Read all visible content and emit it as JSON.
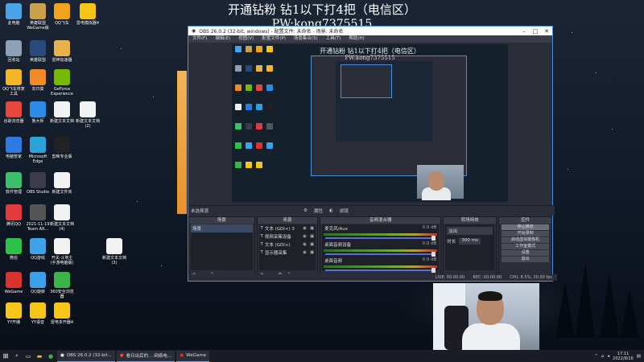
{
  "overlay": {
    "title": "开通钻粉 钻1以下打4把（电信区）",
    "id_line": "PW:kong7375515"
  },
  "desktop": {
    "icons": [
      {
        "label": "此电脑",
        "icon": "computer-icon",
        "color": "#4aa3e8"
      },
      {
        "label": "英雄联盟WeGame版",
        "icon": "lol-icon",
        "color": "#c9a14a"
      },
      {
        "label": "QQ飞车",
        "icon": "qq-speed-icon",
        "color": "#f2a31c"
      },
      {
        "label": "雷电模拟器4",
        "icon": "ldplayer-icon",
        "color": "#f5c518"
      },
      {
        "label": "回收站",
        "icon": "recycle-bin-icon",
        "color": "#8da0b8"
      },
      {
        "label": "英雄联盟",
        "icon": "lol-icon",
        "color": "#2b4a7c"
      },
      {
        "label": "雷神加速器",
        "icon": "leishen-icon",
        "color": "#e8b24a"
      },
      {
        "label": "QQ飞车修复工具",
        "icon": "repair-tool-icon",
        "color": "#f4b626"
      },
      {
        "label": "向日葵",
        "icon": "sunflower-icon",
        "color": "#f08a24"
      },
      {
        "label": "GeForce Experience",
        "icon": "geforce-icon",
        "color": "#76b900"
      },
      {
        "label": "谷歌浏览器",
        "icon": "chrome-icon",
        "color": "#e8453c"
      },
      {
        "label": "鲁大师",
        "icon": "ludashi-icon",
        "color": "#2c8be8"
      },
      {
        "label": "新建文本文档",
        "icon": "text-doc-icon",
        "color": "#f2f2f2"
      },
      {
        "label": "新建文本文档(2)",
        "icon": "text-doc-icon",
        "color": "#f2f2f2"
      },
      {
        "label": "电脑管家",
        "icon": "pc-manager-icon",
        "color": "#2d7be0"
      },
      {
        "label": "Microsoft Edge",
        "icon": "edge-icon",
        "color": "#2aa3d8"
      },
      {
        "label": "剪映专业版",
        "icon": "capcut-icon",
        "color": "#222"
      },
      {
        "label": "软件管理",
        "icon": "software-manager-icon",
        "color": "#3cbf6a"
      },
      {
        "label": "OBS Studio",
        "icon": "obs-icon",
        "color": "#3a3d48"
      },
      {
        "label": "新建文件夹",
        "icon": "text-doc-icon",
        "color": "#f2f2f2"
      },
      {
        "label": "腾讯QQ",
        "icon": "qq-icon",
        "color": "#e23a3a"
      },
      {
        "label": "2021-11-19 Team AR...",
        "icon": "file-icon",
        "color": "#555"
      },
      {
        "label": "新建文本文档(4)",
        "icon": "text-doc-icon",
        "color": "#f2f2f2"
      },
      {
        "label": "微信",
        "icon": "wechat-icon",
        "color": "#2dc14b"
      },
      {
        "label": "QQ游戏",
        "icon": "qq-game-icon",
        "color": "#3da4e8"
      },
      {
        "label": "开关·斗地主(手游电脑版)",
        "icon": "text-doc-icon",
        "color": "#f2f2f2"
      },
      {
        "label": "新建文本文档(3)",
        "icon": "text-doc-icon",
        "color": "#f2f2f2"
      },
      {
        "label": "WeGame",
        "icon": "wegame-icon",
        "color": "#d8332c"
      },
      {
        "label": "QQ旋转",
        "icon": "qq-game-icon",
        "color": "#3ca0e8"
      },
      {
        "label": "360安全浏览器",
        "icon": "browser-360-icon",
        "color": "#3bb34a"
      },
      {
        "label": "YY开播",
        "icon": "yy-icon",
        "color": "#f5c518"
      },
      {
        "label": "YY语音",
        "icon": "yy-icon",
        "color": "#f5c518"
      },
      {
        "label": "雷电多开器4",
        "icon": "ldplayer-icon",
        "color": "#f5c518"
      }
    ]
  },
  "obs": {
    "window_title": "OBS 26.0.2 (32-bit, windows) - 配置文件: 未命名 - 场景: 未命名",
    "menu": [
      "文件(F)",
      "编辑(E)",
      "视图(V)",
      "配置文件(P)",
      "场景集合(S)",
      "工具(T)",
      "帮助(H)"
    ],
    "preview_title": "开通钻粉 钻1以下打4把（电信区）",
    "preview_id": "PW:kong7375515",
    "context_bar": {
      "no_source": "未选择源",
      "properties": "属性",
      "filters": "滤镜"
    },
    "docks": {
      "scenes": {
        "header": "场景",
        "items": [
          "场景"
        ]
      },
      "sources": {
        "header": "来源",
        "items": [
          "文本 (GDI+) 3",
          "视频采集设备",
          "文本 (GDI+)",
          "显示器采集"
        ]
      },
      "mixer": {
        "header": "音频混合器",
        "channels": [
          {
            "name": "麦克风/Aux",
            "db": "0.0 dB"
          },
          {
            "name": "桌面音频设备",
            "db": "0.0 dB"
          },
          {
            "name": "桌面音频",
            "db": "0.0 dB"
          }
        ]
      },
      "transitions": {
        "header": "转场特效",
        "type": "淡出",
        "duration_label": "时长",
        "duration": "300 ms"
      },
      "controls": {
        "header": "控件",
        "buttons": [
          "停止推流",
          "开始录制",
          "启动虚拟摄像机",
          "工作室模式",
          "设置",
          "退出"
        ]
      }
    },
    "status": {
      "live": "LIVE: 00:00:00",
      "rec": "REC: 00:00:00",
      "cpu": "CPU: 8.5%, 30.00 fps"
    }
  },
  "taskbar": {
    "apps": [
      "OBS 26.0.2 (32-bit...",
      "看日出后的…·网络电…",
      "WeGame"
    ],
    "clock_time": "17:11",
    "clock_date": "2022/8/16"
  }
}
